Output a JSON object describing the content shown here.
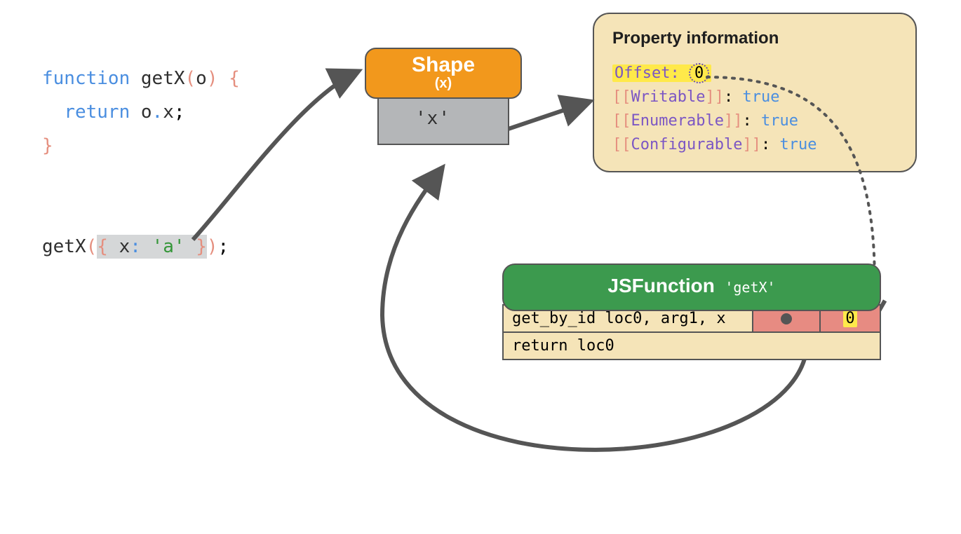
{
  "code": {
    "kw_function": "function",
    "fn_name": "getX",
    "paren_open": "(",
    "param": "o",
    "paren_close": ")",
    "brace_open": "{",
    "kw_return": "return",
    "obj_id": "o",
    "dot": ".",
    "prop_x": "x",
    "semi": ";",
    "brace_close": "}",
    "call_fn": "getX",
    "call_popen": "(",
    "lit_brace_open": "{",
    "lit_key": "x",
    "lit_colon": ":",
    "lit_value": "'a'",
    "lit_brace_close": "}",
    "call_pclose": ")",
    "call_semi": ";"
  },
  "shape": {
    "title": "Shape",
    "sub": "(x)",
    "slot_label": "'x'"
  },
  "prop": {
    "heading": "Property information",
    "offset_label": "Offset:",
    "offset_value": "0",
    "writable_label": "Writable",
    "writable_value": "true",
    "enumerable_label": "Enumerable",
    "enumerable_value": "true",
    "configurable_label": "Configurable",
    "configurable_value": "true"
  },
  "jsfunc": {
    "title": "JSFunction",
    "name": "'getX'",
    "row1_instr": "get_by_id loc0, arg1, x",
    "row1_offset": "0",
    "row2_instr": "return loc0"
  },
  "colors": {
    "shape_header": "#f2981c",
    "jsfunc_header": "#3c9a4e",
    "panel_bg": "#f5e4b8",
    "cache_cell": "#e78b82",
    "highlight": "#ffe94a",
    "arrow": "#555555"
  }
}
